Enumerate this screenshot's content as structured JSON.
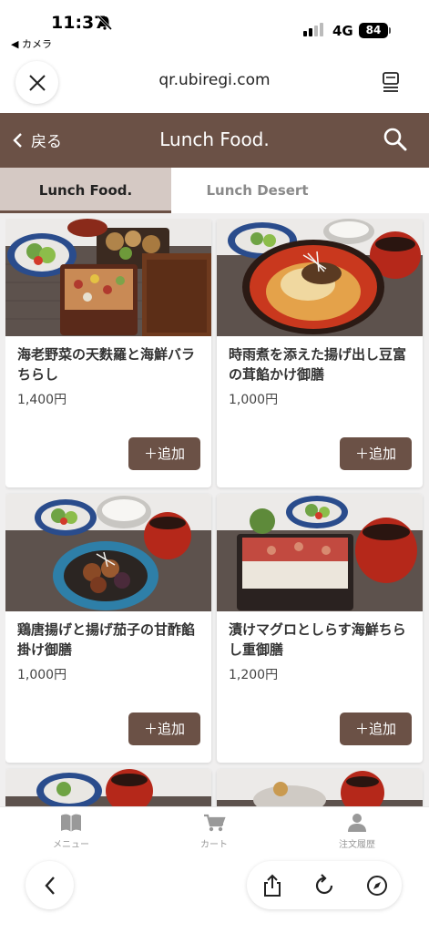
{
  "status": {
    "time": "11:37",
    "back_app": "◀ カメラ",
    "network": "4G",
    "battery": "84"
  },
  "browser": {
    "url": "qr.ubiregi.com"
  },
  "nav": {
    "back_label": "戻る",
    "title": "Lunch Food."
  },
  "tabs": [
    {
      "label": "Lunch Food.",
      "active": true
    },
    {
      "label": "Lunch Desert",
      "active": false
    }
  ],
  "items": [
    {
      "name": "海老野菜の天麩羅と海鮮バラちらし",
      "price": "1,400円",
      "add_label": "＋追加"
    },
    {
      "name": "時雨煮を添えた揚げ出し豆富の茸餡かけ御膳",
      "price": "1,000円",
      "add_label": "＋追加"
    },
    {
      "name": "鶏唐揚げと揚げ茄子の甘酢餡掛け御膳",
      "price": "1,000円",
      "add_label": "＋追加"
    },
    {
      "name": "漬けマグロとしらす海鮮ちらし重御膳",
      "price": "1,200円",
      "add_label": "＋追加"
    }
  ],
  "bottom_nav": [
    {
      "label": "メニュー"
    },
    {
      "label": "カート"
    },
    {
      "label": "注文履歴"
    }
  ],
  "colors": {
    "brand": "#6b5146",
    "tab_active_bg": "#d5c9c4"
  }
}
